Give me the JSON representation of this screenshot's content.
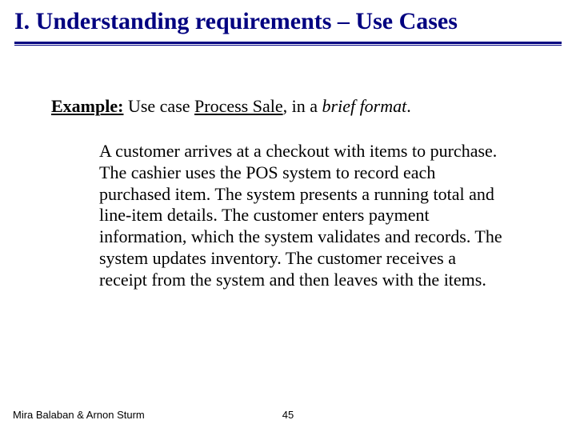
{
  "title": "I. Understanding requirements – Use Cases",
  "example": {
    "label": "Example:",
    "pre": " Use case ",
    "ucname": "Process Sale",
    "mid": ", in a ",
    "format": "brief format",
    "post": "."
  },
  "body": "A customer arrives at a checkout with items to purchase. The cashier uses the POS system to record each purchased item. The system presents a running total and line-item details. The customer enters payment information, which the system validates and records. The system updates inventory. The customer receives a receipt from the system and then leaves with the items.",
  "footer": {
    "authors": "Mira Balaban  &  Arnon Sturm",
    "page": "45"
  }
}
